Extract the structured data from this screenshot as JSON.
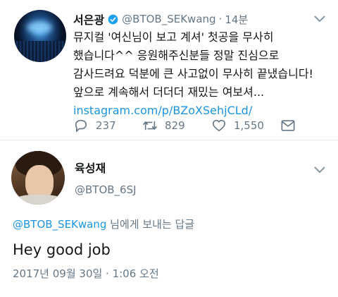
{
  "tweet": {
    "author_name": "서은광",
    "author_handle": "@BTOB_SEKwang",
    "time_sep": "·",
    "time_ago": "14분",
    "lines": [
      "뮤지컬 '여신님이 보고 계셔' 첫공을 무사히",
      "했습니다^^ 응원해주신분들 정말 진심으로",
      "감사드려요 덕분에 큰 사고없이 무사히 끝냈습니다!",
      "앞으로 계속해서 더더더 재밌는 여보셔..."
    ],
    "link": "instagram.com/p/BZoXSehjCLd/",
    "replies": "237",
    "retweets": "829",
    "likes": "1,550"
  },
  "reply": {
    "author_name": "육성재",
    "author_handle": "@BTOB_6SJ",
    "replying_to_handle": "@BTOB_SEKwang",
    "replying_to_suffix": " 님에게 보내는 답글",
    "text": "Hey good job",
    "timestamp": "2017년 09월 30일 · 1:06 오전"
  },
  "icons": {
    "verified": "verified-badge-icon",
    "reply": "reply-icon",
    "retweet": "retweet-icon",
    "like": "heart-icon",
    "dm": "envelope-icon",
    "menu": "chevron-down-icon"
  },
  "colors": {
    "link": "#1b95e0",
    "muted": "#657786",
    "verified": "#1da1f2"
  }
}
